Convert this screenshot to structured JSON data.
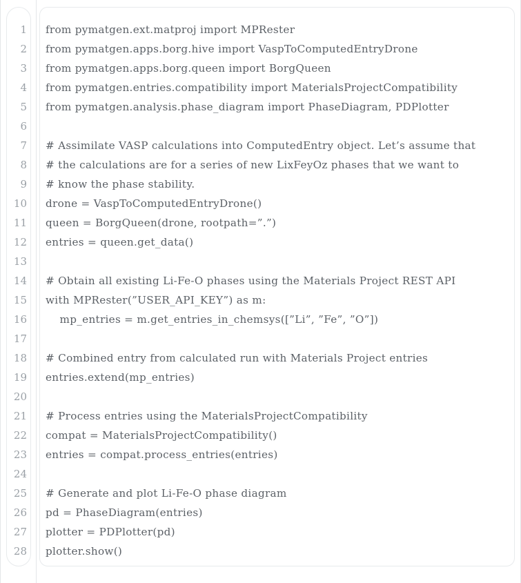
{
  "panel": {
    "language": "python",
    "line_count": 28,
    "border_color": "#e7eaec",
    "text_color": "#5b6066",
    "lineno_color": "#9aa0a6",
    "background": "#ffffff"
  },
  "gutter": {
    "line_numbers": [
      "1",
      "2",
      "3",
      "4",
      "5",
      "6",
      "7",
      "8",
      "9",
      "10",
      "11",
      "12",
      "13",
      "14",
      "15",
      "16",
      "17",
      "18",
      "19",
      "20",
      "21",
      "22",
      "23",
      "24",
      "25",
      "26",
      "27",
      "28"
    ]
  },
  "code": {
    "lines": [
      "from pymatgen.ext.matproj import MPRester",
      "from pymatgen.apps.borg.hive import VaspToComputedEntryDrone",
      "from pymatgen.apps.borg.queen import BorgQueen",
      "from pymatgen.entries.compatibility import MaterialsProjectCompatibility",
      "from pymatgen.analysis.phase_diagram import PhaseDiagram, PDPlotter",
      "",
      "# Assimilate VASP calculations into ComputedEntry object. Let’s assume that",
      "# the calculations are for a series of new LixFeyOz phases that we want to",
      "# know the phase stability.",
      "drone = VaspToComputedEntryDrone()",
      "queen = BorgQueen(drone, rootpath=”.”)",
      "entries = queen.get_data()",
      "",
      "# Obtain all existing Li-Fe-O phases using the Materials Project REST API",
      "with MPRester(”USER_API_KEY”) as m:",
      "    mp_entries = m.get_entries_in_chemsys([”Li”, ”Fe”, ”O”])",
      "",
      "# Combined entry from calculated run with Materials Project entries",
      "entries.extend(mp_entries)",
      "",
      "# Process entries using the MaterialsProjectCompatibility",
      "compat = MaterialsProjectCompatibility()",
      "entries = compat.process_entries(entries)",
      "",
      "# Generate and plot Li-Fe-O phase diagram",
      "pd = PhaseDiagram(entries)",
      "plotter = PDPlotter(pd)",
      "plotter.show()"
    ]
  }
}
